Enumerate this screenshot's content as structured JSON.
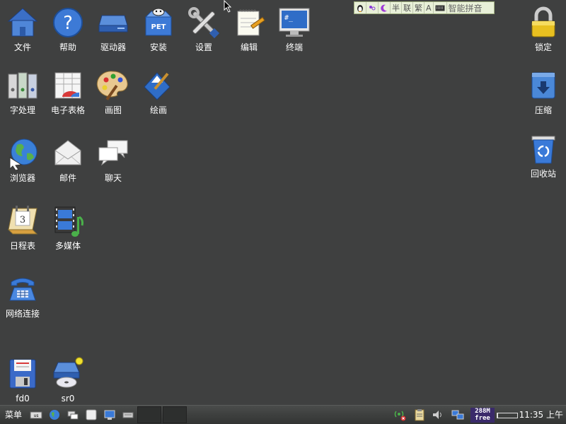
{
  "desktop": {
    "background": "#3f4040",
    "icons": {
      "file": {
        "label": "文件"
      },
      "help": {
        "label": "帮助"
      },
      "drives": {
        "label": "驱动器"
      },
      "install": {
        "label": "安装",
        "badge": "PET"
      },
      "settings": {
        "label": "设置"
      },
      "edit": {
        "label": "编辑"
      },
      "terminal": {
        "label": "终端",
        "screen_text": "#_"
      },
      "lock": {
        "label": "锁定"
      },
      "wordproc": {
        "label": "字处理"
      },
      "spreadsheet": {
        "label": "电子表格"
      },
      "paint": {
        "label": "画图"
      },
      "draw": {
        "label": "绘画"
      },
      "compress": {
        "label": "压缩"
      },
      "browser": {
        "label": "浏览器"
      },
      "mail": {
        "label": "邮件"
      },
      "chat": {
        "label": "聊天"
      },
      "trash": {
        "label": "回收站"
      },
      "calendar": {
        "label": "日程表",
        "day": "3"
      },
      "multimedia": {
        "label": "多媒体"
      },
      "network": {
        "label": "网络连接"
      },
      "fd0": {
        "label": "fd0"
      },
      "sr0": {
        "label": "sr0"
      }
    }
  },
  "ime_bar": {
    "items": [
      "tux-icon",
      "dots-icon",
      "moon-icon",
      "半",
      "联",
      "繁",
      "A",
      "keyboard-icon"
    ],
    "half_label": "半",
    "link_label": "联",
    "trad_label": "繁",
    "alpha_label": "A",
    "mode_label": "智能拼音"
  },
  "taskbar": {
    "menu_label": "菜单",
    "memory": {
      "line1": "288M",
      "line2": "free"
    },
    "clock": "11:35 上午"
  }
}
